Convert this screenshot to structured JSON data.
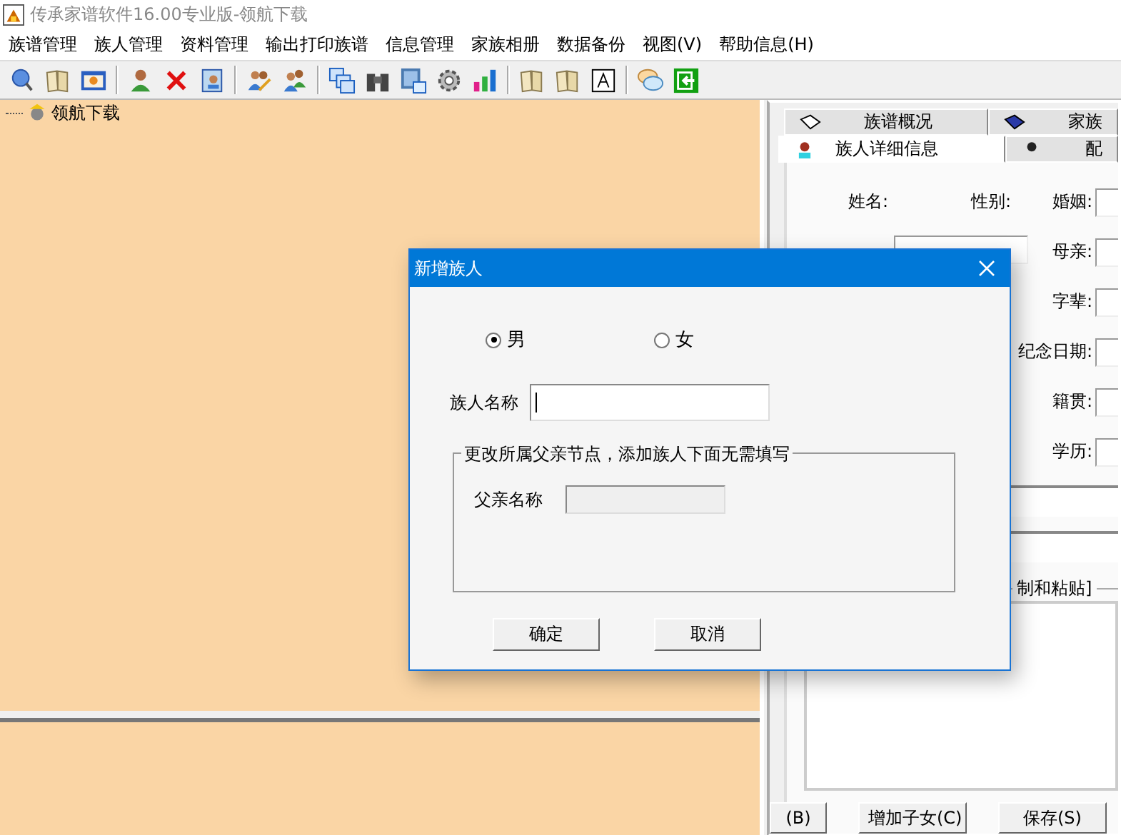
{
  "window": {
    "title": "传承家谱软件16.00专业版-领航下载"
  },
  "menu": [
    "族谱管理",
    "族人管理",
    "资料管理",
    "输出打印族谱",
    "信息管理",
    "家族相册",
    "数据备份",
    "视图(V)",
    "帮助信息(H)"
  ],
  "tree": {
    "items": [
      {
        "label": "领航下载"
      }
    ]
  },
  "tabs_row_1": [
    {
      "label": "族谱概况",
      "selected": false
    },
    {
      "label": "家族",
      "selected": false
    }
  ],
  "tabs_row_2": [
    {
      "label": "族人详细信息",
      "selected": true
    },
    {
      "label": "配",
      "selected": false
    }
  ],
  "details": {
    "rows": [
      {
        "left": "姓名:",
        "middle": "性别:",
        "right": "婚姻:",
        "left_field": false
      },
      {
        "left": "",
        "middle": "",
        "right": "母亲:",
        "left_field": true
      },
      {
        "left": "",
        "middle": "",
        "right": "字辈:",
        "left_field": false
      },
      {
        "left": "",
        "middle": "",
        "right": "纪念日期:",
        "left_field": false
      },
      {
        "left": "",
        "middle": "",
        "right": "籍贯:",
        "left_field": false
      },
      {
        "left": "",
        "middle": "",
        "right": "学历:",
        "left_field": false
      }
    ],
    "group_title": "制和粘贴]",
    "buttons": [
      "(B)",
      "增加子女(C)",
      "保存(S)"
    ]
  },
  "dialog": {
    "title": "新增族人",
    "gender": [
      {
        "label": "男",
        "selected": true
      },
      {
        "label": "女",
        "selected": false
      }
    ],
    "name_label": "族人名称",
    "group_title": "更改所属父亲节点，添加族人下面无需填写",
    "father_label": "父亲名称",
    "father_disabled": true,
    "buttons": [
      "确定",
      "取消"
    ]
  }
}
